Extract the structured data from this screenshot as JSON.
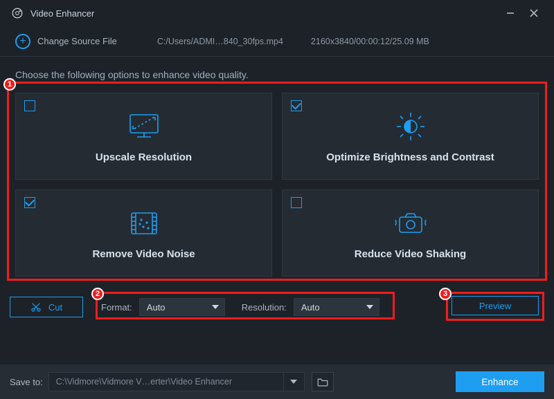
{
  "app": {
    "title": "Video Enhancer"
  },
  "source": {
    "change_label": "Change Source File",
    "path": "C:/Users/ADMI…840_30fps.mp4",
    "meta": "2160x3840/00:00:12/25.09 MB"
  },
  "instruction": "Choose the following options to enhance video quality.",
  "options": [
    {
      "label": "Upscale Resolution",
      "checked": false
    },
    {
      "label": "Optimize Brightness and Contrast",
      "checked": true
    },
    {
      "label": "Remove Video Noise",
      "checked": true
    },
    {
      "label": "Reduce Video Shaking",
      "checked": false
    }
  ],
  "controls": {
    "cut": "Cut",
    "format_label": "Format:",
    "format_value": "Auto",
    "resolution_label": "Resolution:",
    "resolution_value": "Auto",
    "preview": "Preview"
  },
  "bottom": {
    "save_label": "Save to:",
    "save_path": "C:\\Vidmore\\Vidmore V…erter\\Video Enhancer",
    "enhance": "Enhance"
  },
  "annotations": {
    "n1": "1",
    "n2": "2",
    "n3": "3"
  }
}
